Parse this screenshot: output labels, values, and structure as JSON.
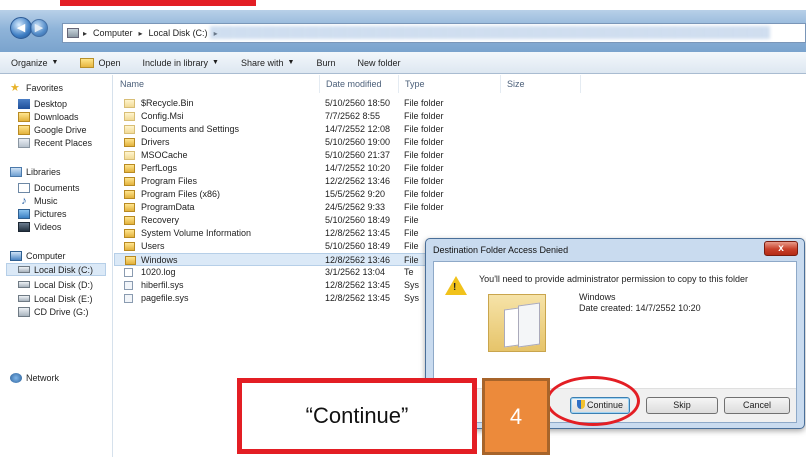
{
  "address_bar": {
    "crumbs": [
      "Computer",
      "Local Disk (C:)"
    ]
  },
  "toolbar": {
    "organize": "Organize",
    "open": "Open",
    "include_in_library": "Include in library",
    "share_with": "Share with",
    "burn": "Burn",
    "new_folder": "New folder"
  },
  "navpane": {
    "favorites": "Favorites",
    "favorites_items": [
      "Desktop",
      "Downloads",
      "Google Drive",
      "Recent Places"
    ],
    "libraries": "Libraries",
    "libraries_items": [
      "Documents",
      "Music",
      "Pictures",
      "Videos"
    ],
    "computer": "Computer",
    "computer_items": [
      "Local Disk (C:)",
      "Local Disk (D:)",
      "Local Disk (E:)",
      "CD Drive (G:)"
    ],
    "network": "Network"
  },
  "columns": {
    "name": "Name",
    "date_modified": "Date modified",
    "type": "Type",
    "size": "Size"
  },
  "files": [
    {
      "name": "$Recycle.Bin",
      "date": "5/10/2560 18:50",
      "type": "File folder"
    },
    {
      "name": "Config.Msi",
      "date": "7/7/2562 8:55",
      "type": "File folder"
    },
    {
      "name": "Documents and Settings",
      "date": "14/7/2552 12:08",
      "type": "File folder"
    },
    {
      "name": "Drivers",
      "date": "5/10/2560 19:00",
      "type": "File folder"
    },
    {
      "name": "MSOCache",
      "date": "5/10/2560 21:37",
      "type": "File folder"
    },
    {
      "name": "PerfLogs",
      "date": "14/7/2552 10:20",
      "type": "File folder"
    },
    {
      "name": "Program Files",
      "date": "12/2/2562 13:46",
      "type": "File folder"
    },
    {
      "name": "Program Files (x86)",
      "date": "15/5/2562 9:20",
      "type": "File folder"
    },
    {
      "name": "ProgramData",
      "date": "24/5/2562 9:33",
      "type": "File folder"
    },
    {
      "name": "Recovery",
      "date": "5/10/2560 18:49",
      "type": "File"
    },
    {
      "name": "System Volume Information",
      "date": "12/8/2562 13:45",
      "type": "File"
    },
    {
      "name": "Users",
      "date": "5/10/2560 18:49",
      "type": "File"
    },
    {
      "name": "Windows",
      "date": "12/8/2562 13:46",
      "type": "File"
    },
    {
      "name": "1020.log",
      "date": "3/1/2562 13:04",
      "type": "Te"
    },
    {
      "name": "hiberfil.sys",
      "date": "12/8/2562 13:45",
      "type": "Sys"
    },
    {
      "name": "pagefile.sys",
      "date": "12/8/2562 13:45",
      "type": "Sys"
    }
  ],
  "dialog": {
    "title": "Destination Folder Access Denied",
    "close": "x",
    "message": "You'll need to provide administrator permission to copy to this folder",
    "folder_name": "Windows",
    "date_created": "Date created: 14/7/2552 10:20",
    "continue": "Continue",
    "skip": "Skip",
    "cancel": "Cancel"
  },
  "annotation": {
    "callout_text": "“Continue”",
    "step_number": "4"
  },
  "colors": {
    "annotation_red": "#e31e24",
    "step_orange": "#ec8a3b"
  }
}
